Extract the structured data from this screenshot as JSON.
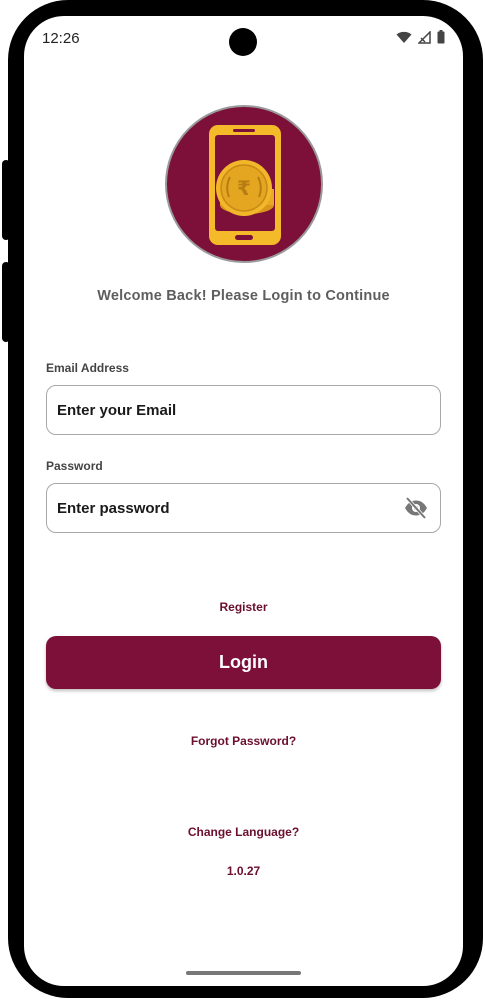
{
  "status_bar": {
    "time": "12:26",
    "icons": [
      "wifi-icon",
      "signal-icon",
      "battery-icon"
    ]
  },
  "header": {
    "logo_icon": "rupee-coin-phone-icon",
    "welcome_text": "Welcome Back! Please Login to Continue"
  },
  "form": {
    "email": {
      "label": "Email Address",
      "placeholder": "Enter your Email",
      "value": ""
    },
    "password": {
      "label": "Password",
      "placeholder": "Enter password",
      "value": "",
      "toggle_icon": "eye-off-icon"
    }
  },
  "actions": {
    "register_label": "Register",
    "login_label": "Login",
    "forgot_label": "Forgot Password?",
    "change_language_label": "Change Language?"
  },
  "footer": {
    "version": "1.0.27"
  },
  "colors": {
    "brand": "#7c1039",
    "link": "#6b0f2e",
    "coin": "#f2b62a"
  }
}
